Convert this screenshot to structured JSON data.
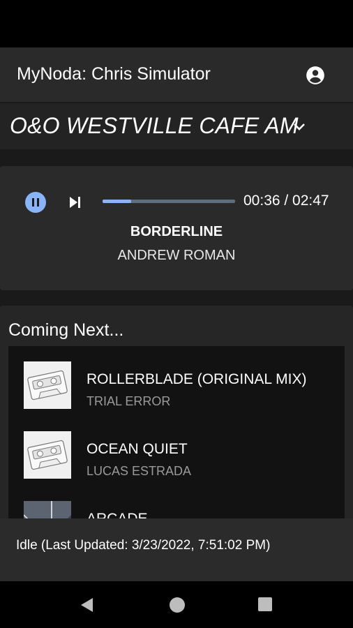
{
  "app": {
    "title": "MyNoda: Chris Simulator",
    "account_icon": "account-circle-icon"
  },
  "location": {
    "name": "O&O WESTVILLE CAFE AM",
    "dropdown_icon": "chevron-down-icon"
  },
  "player": {
    "state": "playing",
    "pause_icon": "pause-icon",
    "skip_icon": "skip-next-icon",
    "progress_fraction": 0.216,
    "time": "00:36 / 02:47",
    "track_title": "BORDERLINE",
    "track_artist": "ANDREW ROMAN"
  },
  "queue": {
    "heading": "Coming Next...",
    "items": [
      {
        "title": "ROLLERBLADE (ORIGINAL MIX)",
        "artist": "TRIAL ERROR",
        "thumb": "cassette-icon"
      },
      {
        "title": "OCEAN QUIET",
        "artist": "LUCAS ESTRADA",
        "thumb": "cassette-icon"
      },
      {
        "title": "ARCADE",
        "artist": "",
        "thumb": "album-art"
      }
    ]
  },
  "status": {
    "text": "Idle (Last Updated: 3/23/2022, 7:51:02 PM)"
  },
  "navbar": {
    "back_icon": "back-icon",
    "home_icon": "home-icon",
    "recent_icon": "recent-apps-icon"
  },
  "colors": {
    "accent": "#8ab4f8",
    "appbar": "#2a2a2a",
    "background": "#1a1a1a"
  }
}
